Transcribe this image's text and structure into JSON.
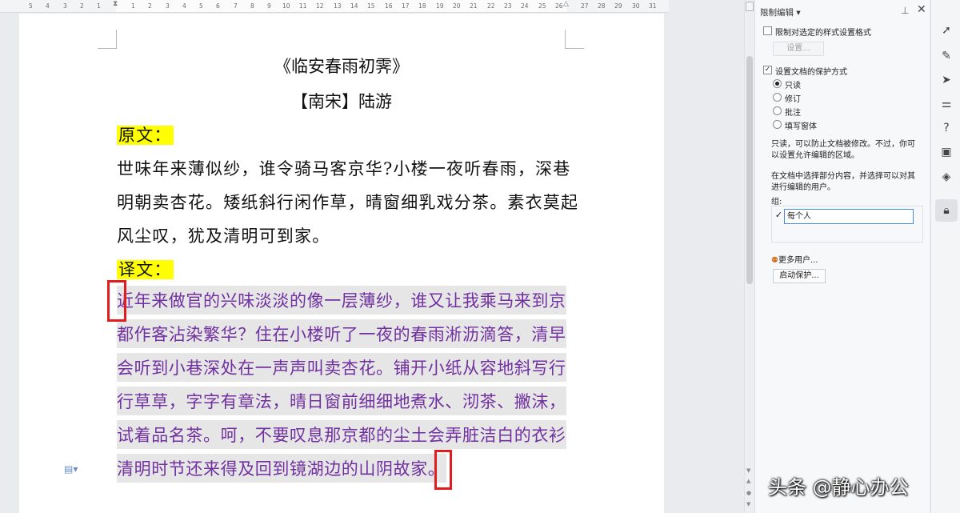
{
  "ruler": {
    "ticks_left": [
      "5",
      "4",
      "3",
      "2",
      "1"
    ],
    "ticks_main": [
      "1",
      "2",
      "3",
      "4",
      "5",
      "6",
      "7",
      "8",
      "9",
      "10",
      "11",
      "12",
      "13",
      "14",
      "15",
      "16",
      "17",
      "18",
      "19",
      "20",
      "21",
      "22",
      "23",
      "24",
      "25",
      "26"
    ],
    "ticks_right": [
      "27",
      "28",
      "29",
      "30",
      "31"
    ]
  },
  "document": {
    "title": "《临安春雨初霁》",
    "author": "【南宋】陆游",
    "original_heading": "原文：",
    "original_lines": [
      "世味年来薄似纱，谁令骑马客京华?小楼一夜听春雨，深巷",
      "明朝卖杏花。矮纸斜行闲作草，晴窗细乳戏分茶。素衣莫起",
      "风尘叹，犹及清明可到家。"
    ],
    "translation_heading": "译文：",
    "translation_lines": [
      "近年来做官的兴味淡淡的像一层薄纱，谁又让我乘马来到京",
      "都作客沾染繁华？住在小楼听了一夜的春雨淅沥滴答，清早",
      "会听到小巷深处在一声声叫卖杏花。铺开小纸从容地斜写行",
      "行草草，字字有章法，晴日窗前细细地煮水、沏茶、撇沫，",
      "试着品名茶。呵，不要叹息那京都的尘土会弄脏洁白的衣衫，",
      "清明时节还来得及回到镜湖边的山阴故家。"
    ],
    "highlight_color": "#ffff00",
    "translation_color": "#7030a0"
  },
  "pane": {
    "title": "限制编辑",
    "format_restrict_label": "限制对选定的样式设置格式",
    "format_restrict_checked": false,
    "settings_button": "设置...",
    "protect_label": "设置文档的保护方式",
    "protect_checked": true,
    "modes": [
      "只读",
      "修订",
      "批注",
      "填写窗体"
    ],
    "selected_mode": "只读",
    "readonly_desc": [
      "只读，可以防止文档被修改。不过，你可",
      "以设置允许编辑的区域。"
    ],
    "select_desc": [
      "在文档中选择部分内容，并选择可以对其",
      "进行编辑的用户。"
    ],
    "group_label": "组:",
    "group_item": "每个人",
    "group_item_checked": true,
    "more_users": "更多用户...",
    "start_protect_button": "启动保护..."
  },
  "icons": [
    "send-icon",
    "pen-icon",
    "cursor-icon",
    "sliders-icon",
    "help-icon",
    "image-tool-icon",
    "location-icon",
    "lock-icon"
  ],
  "watermark": "头条 @静心办公"
}
